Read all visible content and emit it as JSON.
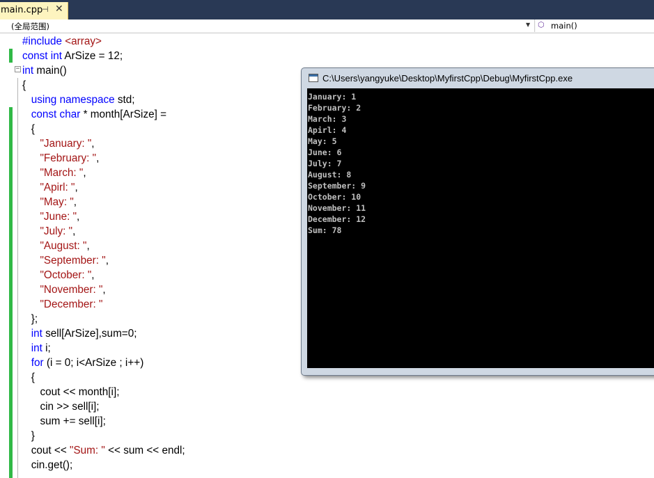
{
  "tab": {
    "label": "main.cpp",
    "pin": "⊣",
    "close": "✕"
  },
  "navbar": {
    "scope": "(全局范围)",
    "scope_arrow": "▼",
    "member": "main()",
    "member_icon": "purple-cube-icon"
  },
  "colors": {
    "keyword": "#0000ff",
    "string": "#a31515",
    "text": "#000000",
    "change_bar": "#30b946",
    "tab_bar": "#293955",
    "active_tab": "#fdf4bf",
    "console_bg": "#000000",
    "console_text": "#c0c0c0"
  },
  "code": {
    "lines": [
      [
        [
          "kw",
          "#include "
        ],
        [
          "str",
          "<array>"
        ]
      ],
      [
        [
          "kw",
          "const int"
        ],
        [
          "t",
          " ArSize = 12;"
        ]
      ],
      [
        [
          "kw",
          "int"
        ],
        [
          "t",
          " main()"
        ]
      ],
      [
        [
          "t",
          "{"
        ]
      ],
      [
        [
          "t",
          "   "
        ],
        [
          "kw",
          "using namespace"
        ],
        [
          "t",
          " std;"
        ]
      ],
      [
        [
          "t",
          "   "
        ],
        [
          "kw",
          "const char"
        ],
        [
          "t",
          " * month[ArSize] ="
        ]
      ],
      [
        [
          "t",
          "   {"
        ]
      ],
      [
        [
          "t",
          "      "
        ],
        [
          "str",
          "\"January: \""
        ],
        [
          "t",
          ","
        ]
      ],
      [
        [
          "t",
          "      "
        ],
        [
          "str",
          "\"February: \""
        ],
        [
          "t",
          ","
        ]
      ],
      [
        [
          "t",
          "      "
        ],
        [
          "str",
          "\"March: \""
        ],
        [
          "t",
          ","
        ]
      ],
      [
        [
          "t",
          "      "
        ],
        [
          "str",
          "\"Apirl: \""
        ],
        [
          "t",
          ","
        ]
      ],
      [
        [
          "t",
          "      "
        ],
        [
          "str",
          "\"May: \""
        ],
        [
          "t",
          ","
        ]
      ],
      [
        [
          "t",
          "      "
        ],
        [
          "str",
          "\"June: \""
        ],
        [
          "t",
          ","
        ]
      ],
      [
        [
          "t",
          "      "
        ],
        [
          "str",
          "\"July: \""
        ],
        [
          "t",
          ","
        ]
      ],
      [
        [
          "t",
          "      "
        ],
        [
          "str",
          "\"August: \""
        ],
        [
          "t",
          ","
        ]
      ],
      [
        [
          "t",
          "      "
        ],
        [
          "str",
          "\"September: \""
        ],
        [
          "t",
          ","
        ]
      ],
      [
        [
          "t",
          "      "
        ],
        [
          "str",
          "\"October: \""
        ],
        [
          "t",
          ","
        ]
      ],
      [
        [
          "t",
          "      "
        ],
        [
          "str",
          "\"November: \""
        ],
        [
          "t",
          ","
        ]
      ],
      [
        [
          "t",
          "      "
        ],
        [
          "str",
          "\"December: \""
        ]
      ],
      [
        [
          "t",
          "   };"
        ]
      ],
      [
        [
          "t",
          "   "
        ],
        [
          "kw",
          "int"
        ],
        [
          "t",
          " sell[ArSize],sum=0;"
        ]
      ],
      [
        [
          "t",
          "   "
        ],
        [
          "kw",
          "int"
        ],
        [
          "t",
          " i;"
        ]
      ],
      [
        [
          "t",
          "   "
        ],
        [
          "kw",
          "for"
        ],
        [
          "t",
          " (i = 0; i<ArSize ; i++)"
        ]
      ],
      [
        [
          "t",
          "   {"
        ]
      ],
      [
        [
          "t",
          "      cout << month[i];"
        ]
      ],
      [
        [
          "t",
          "      cin >> sell[i];"
        ]
      ],
      [
        [
          "t",
          "      sum += sell[i];"
        ]
      ],
      [
        [
          "t",
          "   }"
        ]
      ],
      [
        [
          "t",
          "   cout << "
        ],
        [
          "str",
          "\"Sum: \""
        ],
        [
          "t",
          " << sum << endl;"
        ]
      ],
      [
        [
          "t",
          "   cin.get();"
        ]
      ]
    ]
  },
  "console": {
    "title": "C:\\Users\\yangyuke\\Desktop\\MyfirstCpp\\Debug\\MyfirstCpp.exe",
    "output": [
      "January: 1",
      "February: 2",
      "March: 3",
      "Apirl: 4",
      "May: 5",
      "June: 6",
      "July: 7",
      "August: 8",
      "September: 9",
      "October: 10",
      "November: 11",
      "December: 12",
      "Sum: 78"
    ]
  }
}
